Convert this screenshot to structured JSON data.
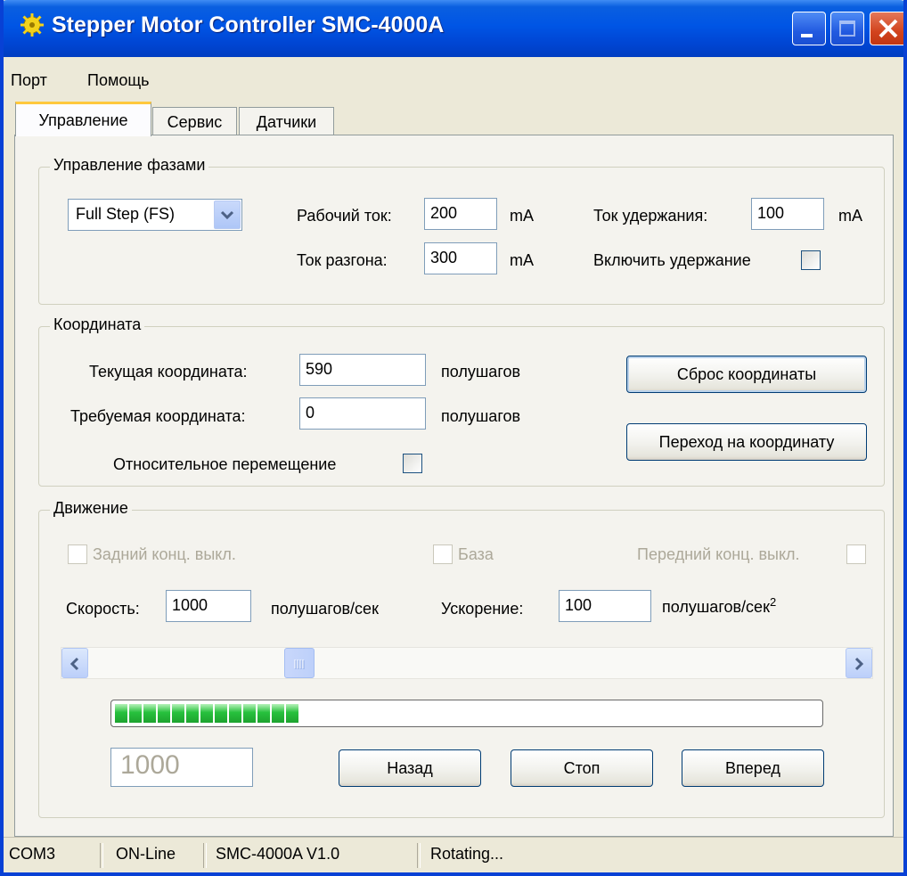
{
  "window": {
    "title": "Stepper Motor Controller SMC-4000A"
  },
  "menu": {
    "items": [
      "Порт",
      "Помощь"
    ]
  },
  "tabs": [
    "Управление",
    "Сервис",
    "Датчики"
  ],
  "phase": {
    "group_label": "Управление фазами",
    "mode": "Full Step (FS)",
    "work_current_label": "Рабочий ток:",
    "work_current_value": "200",
    "accel_current_label": "Ток разгона:",
    "accel_current_value": "300",
    "hold_current_label": "Ток удержания:",
    "hold_current_value": "100",
    "hold_enable_label": "Включить удержание",
    "unit": "mA"
  },
  "coordinate": {
    "group_label": "Координата",
    "current_label": "Текущая координата:",
    "current_value": "590",
    "target_label": "Требуемая координата:",
    "target_value": "0",
    "unit": "полушагов",
    "relative_label": "Относительное перемещение",
    "reset_button": "Сброс координаты",
    "goto_button": "Переход на координату"
  },
  "motion": {
    "group_label": "Движение",
    "rear_limit_label": "Задний конц. выкл.",
    "base_label": "База",
    "front_limit_label": "Передний конц. выкл.",
    "speed_label": "Скорость:",
    "speed_value": "1000",
    "speed_unit": "полушагов/сек",
    "accel_label": "Ускорение:",
    "accel_value": "100",
    "accel_unit": "полушагов/сек",
    "accel_unit_sup": "2",
    "slider_fraction": 0.27,
    "progress_fraction": 0.27,
    "speed_display": "1000",
    "back_button": "Назад",
    "stop_button": "Стоп",
    "forward_button": "Вперед"
  },
  "status": {
    "port": "COM3",
    "state": "ON-Line",
    "device": "SMC-4000A V1.0",
    "message": "Rotating..."
  },
  "colors": {
    "titlebar": "#0055e5",
    "progress_block": "#27c13d",
    "face": "#ece9d8"
  }
}
